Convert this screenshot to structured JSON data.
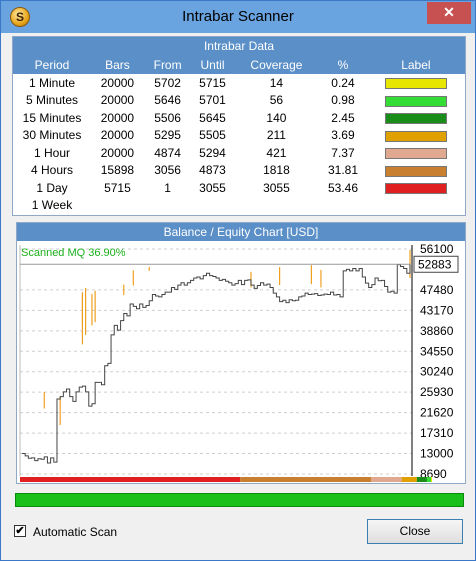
{
  "window": {
    "title": "Intrabar Scanner",
    "close_glyph": "✕",
    "app_icon_letter": "S"
  },
  "intrabar": {
    "title": "Intrabar Data",
    "columns": [
      "Period",
      "Bars",
      "From",
      "Until",
      "Coverage",
      "%",
      "Label"
    ],
    "rows": [
      {
        "period": "1 Minute",
        "bars": "20000",
        "from": "5702",
        "until": "5715",
        "coverage": "14",
        "pct": "0.24",
        "color": "#e6e600"
      },
      {
        "period": "5 Minutes",
        "bars": "20000",
        "from": "5646",
        "until": "5701",
        "coverage": "56",
        "pct": "0.98",
        "color": "#33dd33"
      },
      {
        "period": "15 Minutes",
        "bars": "20000",
        "from": "5506",
        "until": "5645",
        "coverage": "140",
        "pct": "2.45",
        "color": "#1a8c1a"
      },
      {
        "period": "30 Minutes",
        "bars": "20000",
        "from": "5295",
        "until": "5505",
        "coverage": "211",
        "pct": "3.69",
        "color": "#e0a000"
      },
      {
        "period": "1 Hour",
        "bars": "20000",
        "from": "4874",
        "until": "5294",
        "coverage": "421",
        "pct": "7.37",
        "color": "#e0a890"
      },
      {
        "period": "4 Hours",
        "bars": "15898",
        "from": "3056",
        "until": "4873",
        "coverage": "1818",
        "pct": "31.81",
        "color": "#c88030"
      },
      {
        "period": "1 Day",
        "bars": "5715",
        "from": "1",
        "until": "3055",
        "coverage": "3055",
        "pct": "53.46",
        "color": "#e02020"
      },
      {
        "period": "1 Week",
        "bars": "",
        "from": "",
        "until": "",
        "coverage": "",
        "pct": "",
        "color": ""
      }
    ]
  },
  "chart_panel": {
    "title": "Balance / Equity Chart [USD]",
    "scanned_label": "Scanned MQ 36.90%",
    "current_value": "52883"
  },
  "chart_data": {
    "type": "line",
    "title": "Balance / Equity Chart [USD]",
    "ylim": [
      8690,
      56100
    ],
    "y_ticks": [
      56100,
      47480,
      43170,
      38860,
      34550,
      30240,
      25930,
      21620,
      17310,
      13000,
      8690
    ],
    "grid": true,
    "current_value": 52883,
    "annotations": [
      "Scanned MQ 36.90%"
    ],
    "series": [
      {
        "values": [
          13000,
          12500,
          12000,
          12100,
          11500,
          11900,
          11800,
          12300,
          11000,
          12100,
          11200,
          24500,
          25000,
          26000,
          26600,
          25000,
          24000,
          26000,
          27000,
          27200,
          26000,
          23000,
          23500,
          28000,
          28000,
          27500,
          31500,
          32000,
          38000,
          40000,
          39000,
          41000,
          42500,
          42000,
          44500,
          44000,
          43500,
          44500,
          43800,
          44200,
          45200,
          46500,
          46200,
          46000,
          46500,
          47000,
          47000,
          48000,
          47600,
          48500,
          49000,
          48500,
          49000,
          49500,
          50000,
          50200,
          49800,
          50500,
          51000,
          50500,
          50300,
          50000,
          49500,
          49700,
          49300,
          49000,
          48500,
          48800,
          49500,
          48600,
          49500,
          49600,
          48500,
          47800,
          48400,
          49000,
          48500,
          48700,
          48000,
          46800,
          46000,
          45000,
          45300,
          44800,
          45400,
          45200,
          45300,
          46000,
          46200,
          46800,
          46500,
          46600,
          46700,
          46300,
          46400,
          46600,
          46500,
          47000,
          46400,
          46500,
          46000,
          51500,
          51800,
          51500,
          52000,
          51500,
          52000,
          50200,
          48900,
          48000,
          48600,
          50000,
          49400,
          49500,
          48200,
          47000,
          47200,
          46800,
          52800,
          52400,
          52000,
          51000,
          52883
        ]
      }
    ],
    "spikes": [
      [
        24,
        26000,
        22500
      ],
      [
        38,
        19000,
        25000
      ],
      [
        61,
        40000,
        46600
      ],
      [
        62,
        36000,
        47000
      ],
      [
        65,
        38000,
        47900
      ],
      [
        71,
        40000,
        46600
      ],
      [
        76,
        40700,
        47300
      ],
      [
        104,
        46400,
        48600
      ],
      [
        116,
        48400,
        51600
      ],
      [
        132,
        51500,
        52300
      ],
      [
        237,
        48000,
        51300
      ],
      [
        264,
        48500,
        52300
      ],
      [
        298,
        48700,
        52700
      ],
      [
        307,
        48000,
        51700
      ],
      [
        400,
        50000,
        55900
      ]
    ]
  },
  "status_bar": {
    "color": "#19c019"
  },
  "footer": {
    "checkbox_label": "Automatic Scan",
    "checked": true,
    "check_glyph": "✔",
    "close_label": "Close"
  }
}
